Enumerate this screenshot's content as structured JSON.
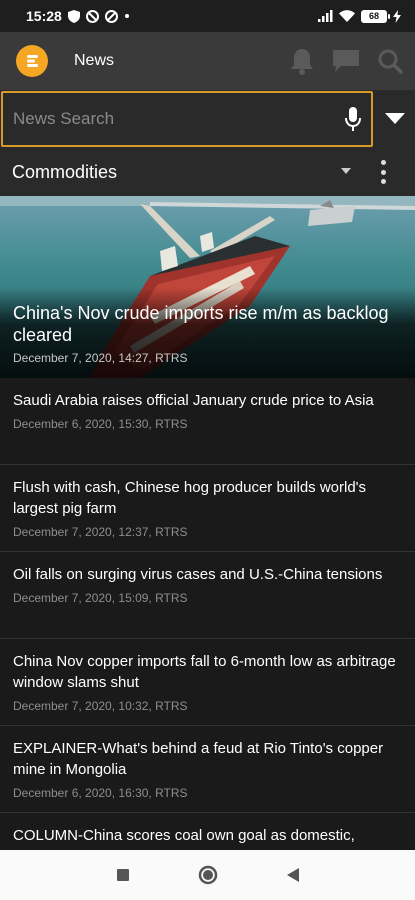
{
  "status_bar": {
    "time": "15:28",
    "battery": "68",
    "icons": [
      "shield-icon",
      "do-not-disturb-icon",
      "sync-icon",
      "dot-icon",
      "signal-icon",
      "wifi-icon",
      "battery-icon",
      "charging-icon"
    ]
  },
  "app_bar": {
    "title": "News",
    "logo_color": "#f5a623",
    "actions": [
      "bell-icon",
      "chat-icon",
      "search-icon"
    ]
  },
  "search": {
    "placeholder": "News Search",
    "border_color": "#d99a29"
  },
  "category": {
    "selected": "Commodities"
  },
  "featured": {
    "title": "China's Nov crude imports rise m/m as backlog cleared",
    "meta": "December 7, 2020, 14:27, RTRS"
  },
  "articles": [
    {
      "title": "Saudi Arabia raises official January crude price to Asia",
      "meta": "December 6, 2020, 15:30, RTRS"
    },
    {
      "title": "Flush with cash, Chinese hog producer builds world's largest pig farm",
      "meta": "December 7, 2020, 12:37, RTRS"
    },
    {
      "title": "Oil falls on surging virus cases and U.S.-China tensions",
      "meta": "December 7, 2020, 15:09, RTRS"
    },
    {
      "title": "China Nov copper imports fall to 6-month low as arbitrage window slams shut",
      "meta": "December 7, 2020, 10:32, RTRS"
    },
    {
      "title": "EXPLAINER-What's behind a feud at Rio Tinto's copper mine in Mongolia",
      "meta": "December 6, 2020, 16:30, RTRS"
    },
    {
      "title": "COLUMN-China scores coal own goal as domestic,",
      "meta": ""
    }
  ],
  "nav_bar": {
    "buttons": [
      "recents-square-icon",
      "home-circle-icon",
      "back-triangle-icon"
    ]
  }
}
